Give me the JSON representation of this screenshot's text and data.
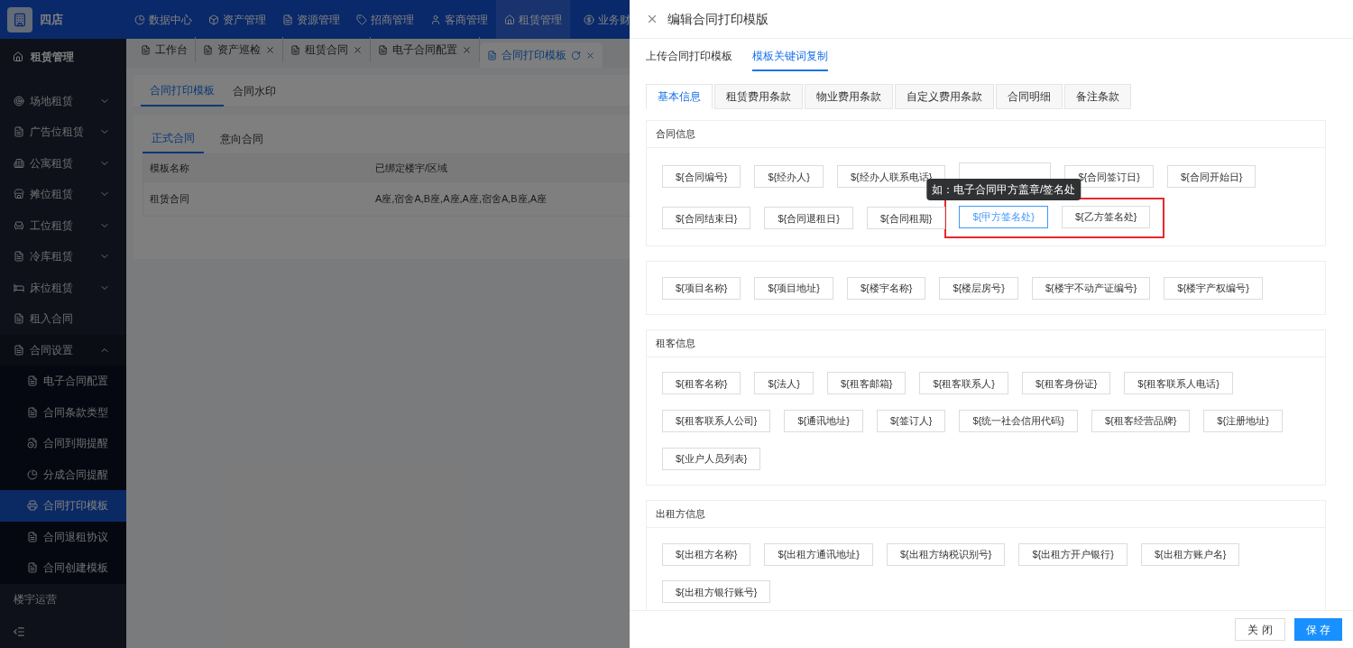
{
  "brand": {
    "name": "四店"
  },
  "top_nav": [
    {
      "label": "数据中心",
      "selected": false
    },
    {
      "label": "资产管理",
      "selected": false
    },
    {
      "label": "资源管理",
      "selected": false
    },
    {
      "label": "招商管理",
      "selected": false
    },
    {
      "label": "客商管理",
      "selected": false
    },
    {
      "label": "租赁管理",
      "selected": true
    },
    {
      "label": "业务财",
      "selected": false
    }
  ],
  "sidebar": {
    "title": "租赁管理",
    "items": [
      {
        "label": "场地租赁",
        "kind": "group",
        "expanded": false
      },
      {
        "label": "广告位租赁",
        "kind": "group",
        "expanded": false
      },
      {
        "label": "公寓租赁",
        "kind": "group",
        "expanded": false
      },
      {
        "label": "摊位租赁",
        "kind": "group",
        "expanded": false
      },
      {
        "label": "工位租赁",
        "kind": "group",
        "expanded": false
      },
      {
        "label": "冷库租赁",
        "kind": "group",
        "expanded": false
      },
      {
        "label": "床位租赁",
        "kind": "group",
        "expanded": false
      },
      {
        "label": "租入合同",
        "kind": "link"
      },
      {
        "label": "合同设置",
        "kind": "group",
        "expanded": true,
        "children": [
          {
            "label": "电子合同配置",
            "selected": false
          },
          {
            "label": "合同条款类型",
            "selected": false
          },
          {
            "label": "合同到期提醒",
            "selected": false
          },
          {
            "label": "分成合同提醒",
            "selected": false
          },
          {
            "label": "合同打印模板",
            "selected": true
          },
          {
            "label": "合同退租协议",
            "selected": false
          },
          {
            "label": "合同创建模板",
            "selected": false
          }
        ]
      },
      {
        "label": "楼宇运营",
        "kind": "link"
      }
    ]
  },
  "page_tabs": [
    {
      "label": "工作台",
      "selected": false
    },
    {
      "label": "资产巡检",
      "selected": false
    },
    {
      "label": "租赁合同",
      "selected": false
    },
    {
      "label": "电子合同配置",
      "selected": false
    },
    {
      "label": "合同打印模板",
      "selected": true
    }
  ],
  "content_tabs": [
    {
      "label": "合同打印模板",
      "selected": true
    },
    {
      "label": "合同水印",
      "selected": false
    }
  ],
  "contract_tabs": [
    {
      "label": "正式合同",
      "selected": true
    },
    {
      "label": "意向合同",
      "selected": false
    }
  ],
  "table": {
    "columns": [
      "模板名称",
      "已绑定楼宇/区域"
    ],
    "rows": [
      [
        "租赁合同",
        "A座,宿舍A,B座,A座,A座,宿舍A,B座,A座"
      ]
    ]
  },
  "drawer": {
    "title": "编辑合同打印模版",
    "tabs": [
      {
        "label": "上传合同打印模板",
        "selected": false
      },
      {
        "label": "模板关键词复制",
        "selected": true
      }
    ],
    "sub_tabs": [
      {
        "label": "基本信息",
        "selected": true
      },
      {
        "label": "租赁费用条款",
        "selected": false
      },
      {
        "label": "物业费用条款",
        "selected": false
      },
      {
        "label": "自定义费用条款",
        "selected": false
      },
      {
        "label": "合同明细",
        "selected": false
      },
      {
        "label": "备注条款",
        "selected": false
      }
    ],
    "sections": [
      {
        "title": "合同信息",
        "keywords": [
          {
            "text": "${合同编号}",
            "selected": false,
            "highlighted": false
          },
          {
            "text": "${经办人}",
            "selected": false,
            "highlighted": false
          },
          {
            "text": "${经办人联系电话}",
            "selected": false,
            "highlighted": false
          },
          {
            "selected": false,
            "highlighted": false
          },
          {
            "text": "${合同签订日}",
            "selected": false,
            "highlighted": false
          },
          {
            "text": "${合同开始日}",
            "selected": false,
            "highlighted": false
          },
          {
            "text": "${合同结束日}",
            "selected": false,
            "highlighted": false
          },
          {
            "text": "${合同退租日}",
            "selected": false,
            "highlighted": false
          },
          {
            "text": "${合同租期}",
            "selected": false,
            "highlighted": false
          },
          {
            "text": "${甲方签名处}",
            "selected": true,
            "highlighted": true,
            "tooltip": "如：电子合同甲方盖章/签名处"
          },
          {
            "text": "${乙方签名处}",
            "selected": false,
            "highlighted": true
          }
        ]
      },
      {
        "keywords": [
          {
            "text": "${项目名称}",
            "selected": false,
            "highlighted": false
          },
          {
            "text": "${项目地址}",
            "selected": false,
            "highlighted": false
          },
          {
            "text": "${楼宇名称}",
            "selected": false,
            "highlighted": false
          },
          {
            "text": "${楼层房号}",
            "selected": false,
            "highlighted": false
          },
          {
            "text": "${楼宇不动产证编号}",
            "selected": false,
            "highlighted": false
          },
          {
            "text": "${楼宇产权编号}",
            "selected": false,
            "highlighted": false
          }
        ]
      },
      {
        "title": "租客信息",
        "keywords": [
          {
            "text": "${租客名称}",
            "selected": false,
            "highlighted": false
          },
          {
            "text": "${法人}",
            "selected": false,
            "highlighted": false
          },
          {
            "text": "${租客邮箱}",
            "selected": false,
            "highlighted": false
          },
          {
            "text": "${租客联系人}",
            "selected": false,
            "highlighted": false
          },
          {
            "text": "${租客身份证}",
            "selected": false,
            "highlighted": false
          },
          {
            "text": "${租客联系人电话}",
            "selected": false,
            "highlighted": false
          },
          {
            "text": "${租客联系人公司}",
            "selected": false,
            "highlighted": false
          },
          {
            "text": "${通讯地址}",
            "selected": false,
            "highlighted": false
          },
          {
            "text": "${签订人}",
            "selected": false,
            "highlighted": false
          },
          {
            "text": "${统一社会信用代码}",
            "selected": false,
            "highlighted": false
          },
          {
            "text": "${租客经营品牌}",
            "selected": false,
            "highlighted": false
          },
          {
            "text": "${注册地址}",
            "selected": false,
            "highlighted": false
          },
          {
            "text": "${业户人员列表}",
            "selected": false,
            "highlighted": false
          }
        ]
      },
      {
        "title": "出租方信息",
        "keywords": [
          {
            "text": "${出租方名称}",
            "selected": false,
            "highlighted": false
          },
          {
            "text": "${出租方通讯地址}",
            "selected": false,
            "highlighted": false
          },
          {
            "text": "${出租方纳税识别号}",
            "selected": false,
            "highlighted": false
          },
          {
            "text": "${出租方开户银行}",
            "selected": false,
            "highlighted": false
          },
          {
            "text": "${出租方账户名}",
            "selected": false,
            "highlighted": false
          },
          {
            "text": "${出租方银行账号}",
            "selected": false,
            "highlighted": false
          }
        ]
      }
    ],
    "buttons": [
      {
        "label": "关 闭",
        "kind": "default"
      },
      {
        "label": "保 存",
        "kind": "primary"
      }
    ]
  }
}
